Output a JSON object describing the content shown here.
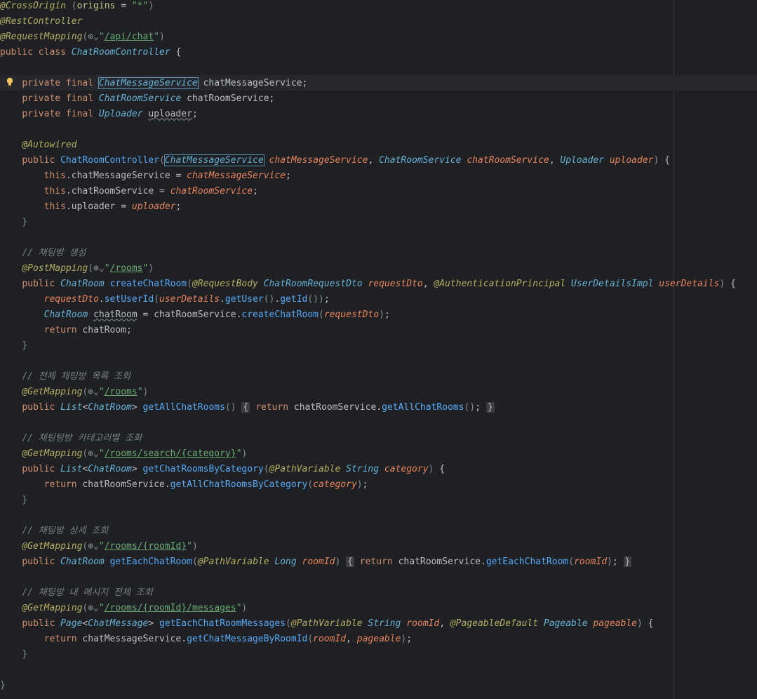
{
  "comments": {
    "create": "// 채팅방 생성",
    "list_all": "// 전체 채팅방 목록 조회",
    "by_category": "// 채팅팅방 카테고리별 조회",
    "detail": "// 채팅방 상세 조회",
    "messages": "// 채팅방 내 메시지 전체 조회"
  },
  "paths": {
    "base": "/api/chat",
    "rooms": "/rooms",
    "rooms_get": "/rooms",
    "search": "/rooms/search/{category}",
    "room": "/rooms/{roomId}",
    "messages": "/rooms/{roomId}/messages"
  },
  "origins_value": "\"*\"",
  "class_name": "ChatRoomController",
  "icons": {
    "bulb": "lightbulb-icon",
    "globe": "globe-icon"
  },
  "colors": {
    "background": "#1f2024",
    "keyword": "#cf8e6d",
    "annotation": "#b3ae60",
    "string": "#6aab73",
    "comment": "#7a7e85",
    "type": "#66b1d5",
    "parameter": "#e8845c",
    "method": "#56a8f5"
  }
}
